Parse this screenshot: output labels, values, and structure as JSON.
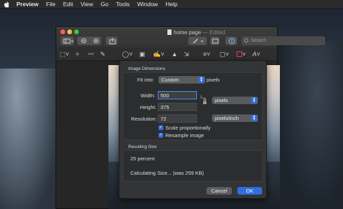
{
  "menubar": {
    "app": "Preview",
    "items": [
      "File",
      "Edit",
      "View",
      "Go",
      "Tools",
      "Window",
      "Help"
    ]
  },
  "window": {
    "title": "home page",
    "status": "— Edited",
    "search_placeholder": "Search"
  },
  "dialog": {
    "section_dimensions": "Image Dimensions",
    "fit_into_label": "Fit into:",
    "fit_into_value": "Custom",
    "fit_into_unit": "pixels",
    "width_label": "Width:",
    "width_value": "500",
    "height_label": "Height:",
    "height_value": "375",
    "size_unit": "pixels",
    "resolution_label": "Resolution:",
    "resolution_value": "72",
    "resolution_unit": "pixels/inch",
    "scale_label": "Scale proportionally",
    "resample_label": "Resample image",
    "section_result": "Resulting Size",
    "result_percent": "25 percent",
    "result_size": "Calculating Size... (was 259 KB)",
    "cancel_label": "Cancel",
    "ok_label": "OK"
  },
  "colors": {
    "accent": "#2f6fe0",
    "close": "#fc605c",
    "minimize": "#fdbc40",
    "zoom": "#34c84a"
  }
}
